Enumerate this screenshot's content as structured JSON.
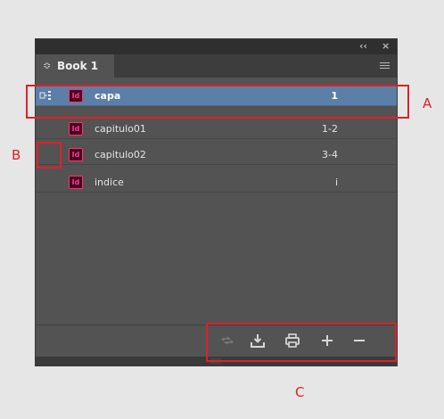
{
  "panel": {
    "collapse_label": "‹‹",
    "close_label": "×",
    "tab_arrows": "≎",
    "tab_title": "Book 1"
  },
  "documents": [
    {
      "name": "capa",
      "pages": "1",
      "selected": true
    },
    {
      "name": "capitulo01",
      "pages": "1-2",
      "selected": false
    },
    {
      "name": "capitulo02",
      "pages": "3-4",
      "selected": false
    },
    {
      "name": "indice",
      "pages": "i",
      "selected": false
    }
  ],
  "doc_icon_label": "Id",
  "annotations": {
    "a": "A",
    "b": "B",
    "c": "C"
  },
  "colors": {
    "selected_row": "#5b7fa6",
    "annotation": "#e0202a",
    "indesign_icon": "#ff3366"
  }
}
